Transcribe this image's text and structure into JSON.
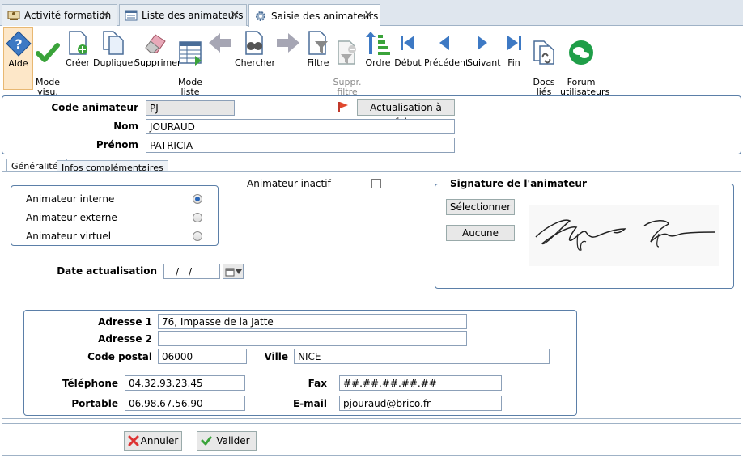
{
  "tabs": [
    {
      "label": "Activité formation"
    },
    {
      "label": "Liste des animateurs"
    },
    {
      "label": "Saisie des animateurs"
    }
  ],
  "toolbar": {
    "aide": "Aide",
    "mode_visu": "Mode\nvisu.",
    "creer": "Créer",
    "dupliquer": "Dupliquer",
    "supprimer": "Supprimer",
    "mode_liste": "Mode\nliste",
    "chercher": "Chercher",
    "filtre": "Filtre",
    "suppr_filtre": "Suppr.\nfiltre",
    "ordre": "Ordre",
    "debut": "Début",
    "precedent": "Précédent",
    "suivant": "Suivant",
    "fin": "Fin",
    "docs_lies": "Docs\nliés",
    "forum": "Forum\nutilisateurs"
  },
  "header": {
    "code_label": "Code animateur",
    "code_value": "PJ",
    "actualisation_button": "Actualisation à faire",
    "nom_label": "Nom",
    "nom_value": "JOURAUD",
    "prenom_label": "Prénom",
    "prenom_value": "PATRICIA"
  },
  "subtabs": {
    "generalites": "Généralités",
    "infos": "Infos complémentaires"
  },
  "general": {
    "inactif_label": "Animateur inactif",
    "type_options": [
      "Animateur interne",
      "Animateur externe",
      "Animateur virtuel"
    ],
    "date_label": "Date actualisation",
    "date_value": "__/__/____",
    "signature_title": "Signature de l'animateur",
    "select_button": "Sélectionner",
    "none_button": "Aucune"
  },
  "address": {
    "adresse1_label": "Adresse 1",
    "adresse1_value": "76, Impasse de la Jatte",
    "adresse2_label": "Adresse 2",
    "adresse2_value": "",
    "cp_label": "Code postal",
    "cp_value": "06000",
    "ville_label": "Ville",
    "ville_value": "NICE",
    "tel_label": "Téléphone",
    "tel_value": "04.32.93.23.45",
    "fax_label": "Fax",
    "fax_value": "##.##.##.##.##",
    "portable_label": "Portable",
    "portable_value": "06.98.67.56.90",
    "email_label": "E-mail",
    "email_value": "pjouraud@brico.fr"
  },
  "footer": {
    "annuler": "Annuler",
    "valider": "Valider"
  }
}
